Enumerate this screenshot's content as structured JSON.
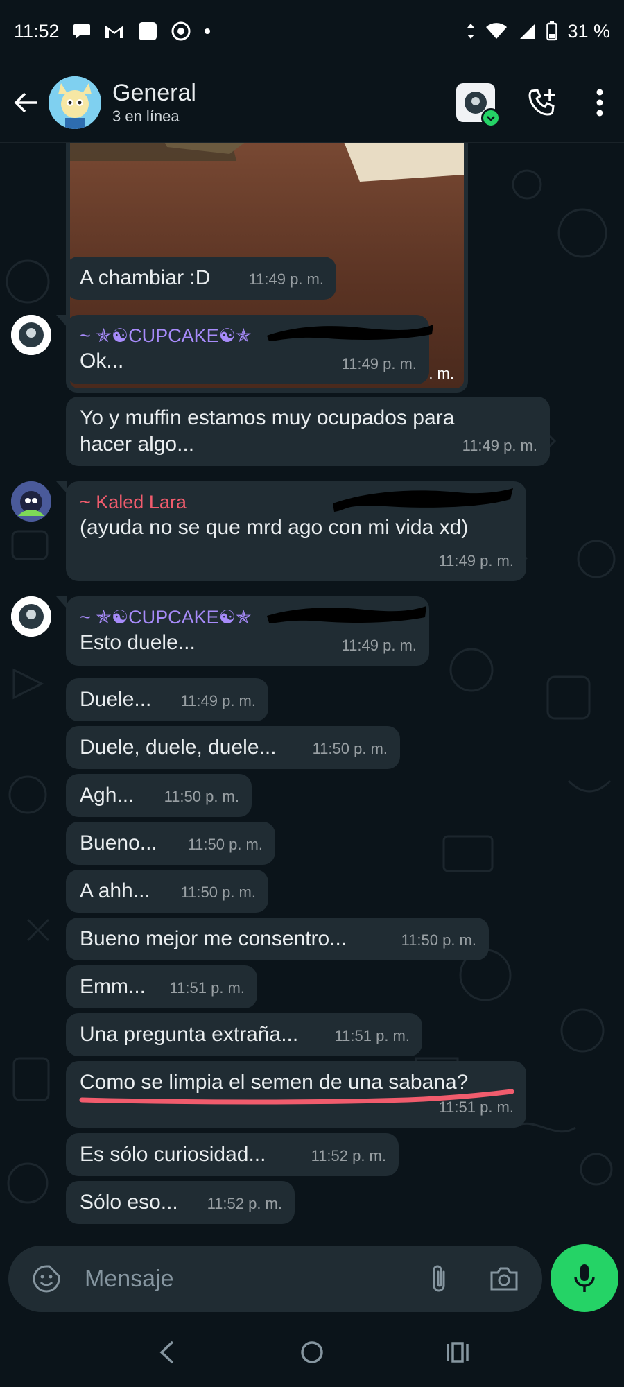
{
  "status_bar": {
    "time": "11:52",
    "battery": "31 %"
  },
  "header": {
    "title": "General",
    "subtitle": "3 en línea"
  },
  "messages": [
    {
      "type": "image",
      "time": "11:48 p. m."
    },
    {
      "text": "A chambiar :D",
      "time": "11:49 p. m."
    },
    {
      "sender": "~ ✯☯CUPCAKE☯✯",
      "sender_color": "#a78bfa",
      "text": "Ok...",
      "time": "11:49 p. m."
    },
    {
      "text": "Yo y muffin estamos muy ocupados para hacer algo...",
      "time": "11:49 p. m."
    },
    {
      "sender": "~ Kaled Lara",
      "sender_color": "#f15c6d",
      "text": "(ayuda no se que mrd ago con mi vida xd)",
      "time": "11:49 p. m."
    },
    {
      "sender": "~ ✯☯CUPCAKE☯✯",
      "sender_color": "#a78bfa",
      "text": "Esto duele...",
      "time": "11:49 p. m."
    },
    {
      "text": "Duele...",
      "time": "11:49 p. m."
    },
    {
      "text": "Duele, duele, duele...",
      "time": "11:50 p. m."
    },
    {
      "text": "Agh...",
      "time": "11:50 p. m."
    },
    {
      "text": "Bueno...",
      "time": "11:50 p. m."
    },
    {
      "text": "A ahh...",
      "time": "11:50 p. m."
    },
    {
      "text": "Bueno mejor me consentro...",
      "time": "11:50 p. m."
    },
    {
      "text": "Emm...",
      "time": "11:51 p. m."
    },
    {
      "text": "Una pregunta extraña...",
      "time": "11:51 p. m."
    },
    {
      "text": "Como se limpia el semen de una  sabana?",
      "time": "11:51 p. m.",
      "underline_color": "#f15c6d"
    },
    {
      "text": "Es sólo curiosidad...",
      "time": "11:52 p. m."
    },
    {
      "text": "Sólo eso...",
      "time": "11:52 p. m."
    }
  ],
  "input": {
    "placeholder": "Mensaje"
  },
  "colors": {
    "background": "#0b141a",
    "bubble": "#202c33",
    "accent_green": "#25d366",
    "cupcake": "#a78bfa",
    "kaled": "#f15c6d"
  },
  "icons": {
    "back": "arrow-left-icon",
    "call": "add-call-icon",
    "menu": "more-vertical-icon",
    "emoji": "sticker-icon",
    "attach": "paperclip-icon",
    "camera": "camera-icon",
    "mic": "mic-icon"
  }
}
